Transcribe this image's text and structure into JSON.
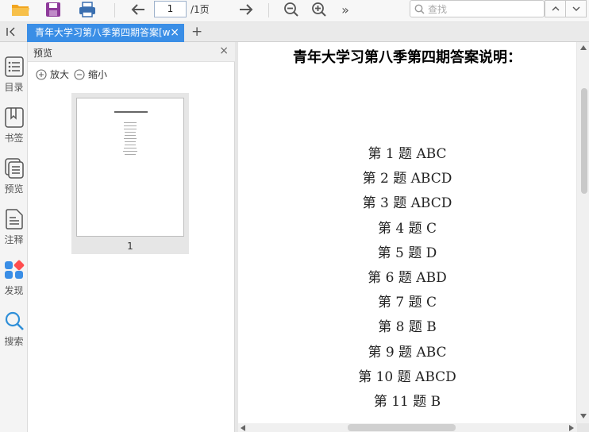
{
  "toolbar": {
    "page_value": "1",
    "page_total": "/1页",
    "more": "»",
    "search_placeholder": "查找"
  },
  "tabs": {
    "doc_tab_title": "青年大学习第八季第四期答案[w",
    "close": "×",
    "add": "+"
  },
  "sidebar": {
    "items": [
      {
        "label": "目录"
      },
      {
        "label": "书签"
      },
      {
        "label": "预览"
      },
      {
        "label": "注释"
      },
      {
        "label": "发现"
      },
      {
        "label": "搜索"
      }
    ]
  },
  "panel": {
    "title": "预览",
    "close": "×",
    "zoom_in": "放大",
    "zoom_out": "缩小",
    "thumb_number": "1"
  },
  "document": {
    "title": "青年大学习第八季第四期答案说明：",
    "answers": [
      "第 1 题 ABC",
      "第 2 题 ABCD",
      "第 3 题 ABCD",
      "第 4 题 C",
      "第 5 题 D",
      "第 6 题 ABD",
      "第 7 题 C",
      "第 8 题 B",
      "第 9 题 ABC",
      "第 10 题 ABCD",
      "第 11 题 B"
    ]
  },
  "colors": {
    "accent": "#3a8ee6",
    "folder": "#f2a51f",
    "save": "#8e3a9a",
    "discover_red": "#ff4d4f",
    "discover_blue": "#3a8ee6"
  }
}
